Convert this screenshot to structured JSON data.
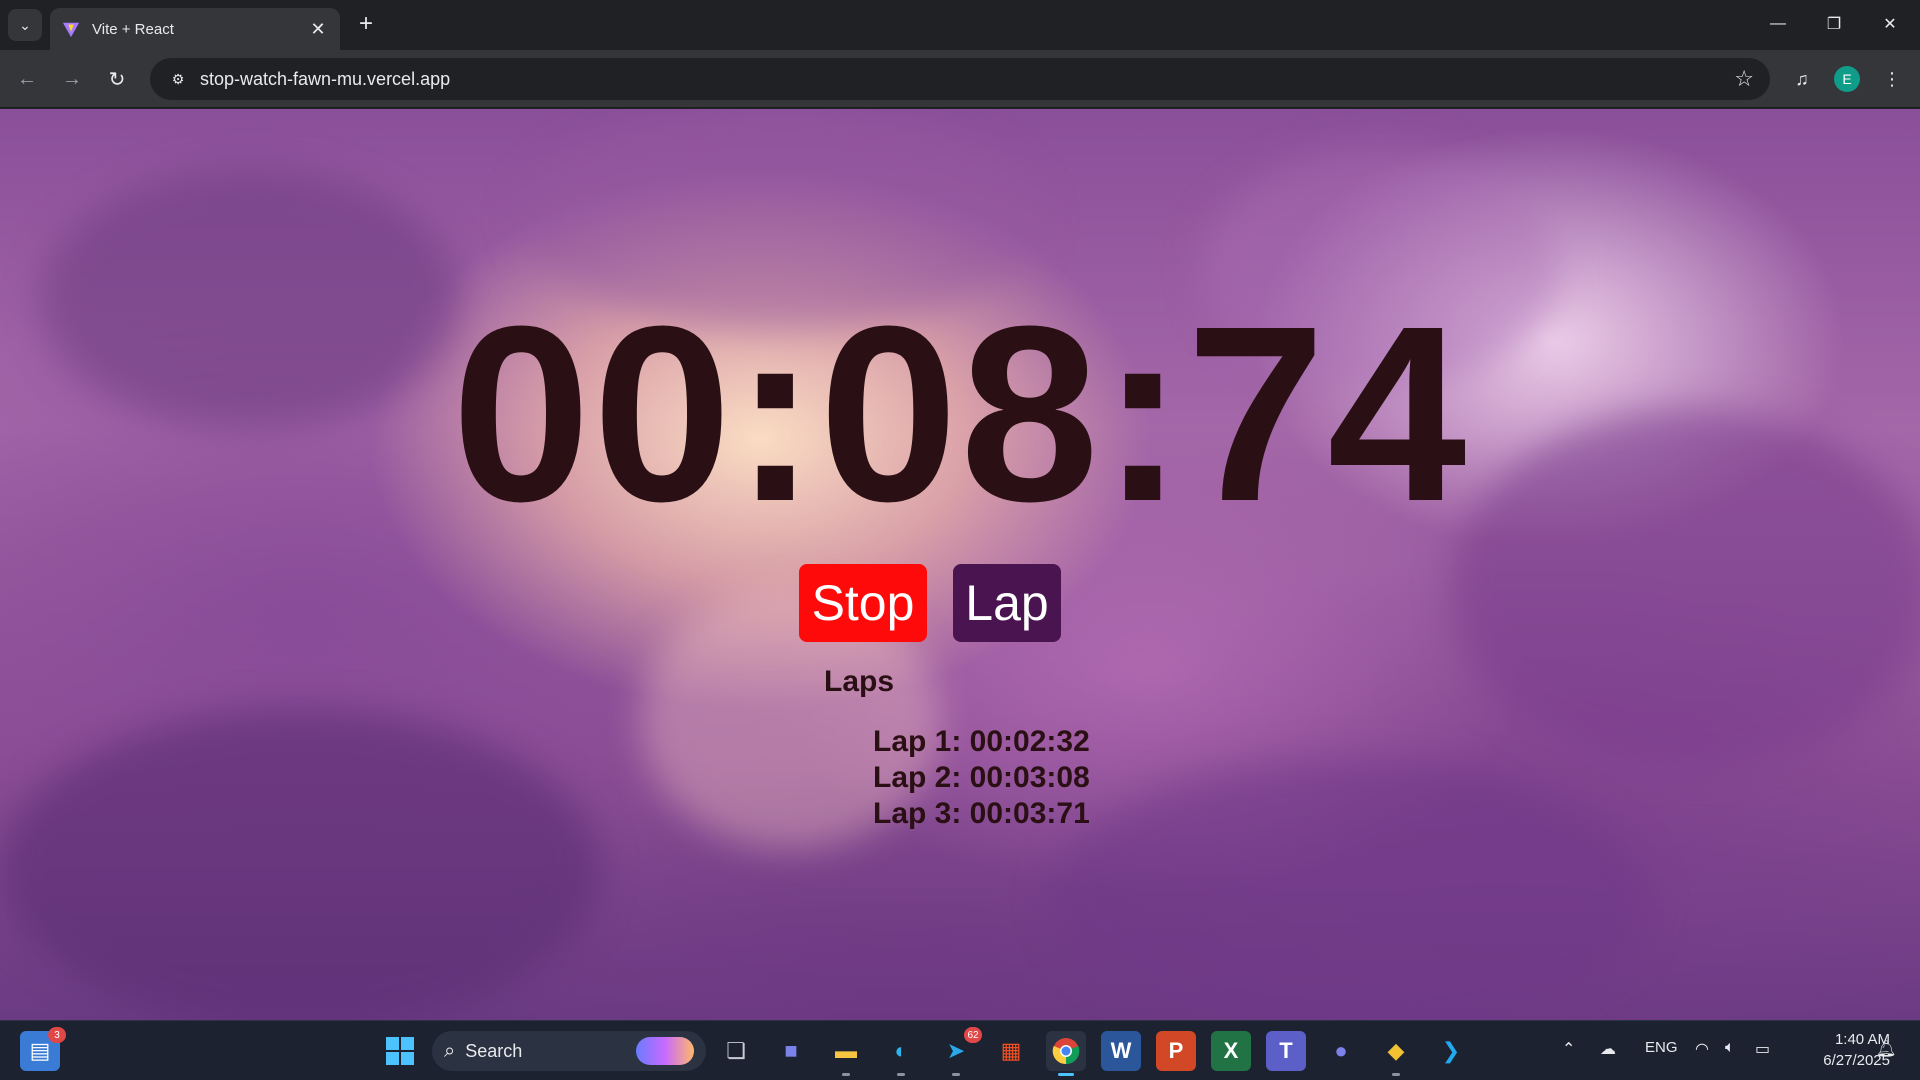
{
  "browser": {
    "tab": {
      "title": "Vite + React",
      "favicon": "vite-logo-icon"
    },
    "new_tab_label": "+",
    "url": "stop-watch-fawn-mu.vercel.app",
    "profile_initial": "E"
  },
  "stopwatch": {
    "time": "00:08:74",
    "buttons": {
      "stop": "Stop",
      "lap": "Lap"
    },
    "laps_heading": "Laps",
    "laps": [
      "Lap 1: 00:02:32",
      "Lap 2: 00:03:08",
      "Lap 3: 00:03:71"
    ],
    "colors": {
      "stop": "#ff0a0a",
      "lap": "#4a1450",
      "text": "#2a1014"
    }
  },
  "taskbar": {
    "widgets_badge": "3",
    "search_label": "Search",
    "telegram_badge": "62",
    "language": "ENG",
    "time": "1:40 AM",
    "date": "6/27/2025",
    "apps": [
      "windows-start-icon",
      "task-view-icon",
      "meet-icon",
      "file-explorer-icon",
      "edge-icon",
      "telegram-icon",
      "store-icon",
      "chrome-icon",
      "word-icon",
      "powerpoint-icon",
      "excel-icon",
      "teams-icon",
      "teams-classic-icon",
      "git-icon",
      "vscode-icon"
    ]
  }
}
